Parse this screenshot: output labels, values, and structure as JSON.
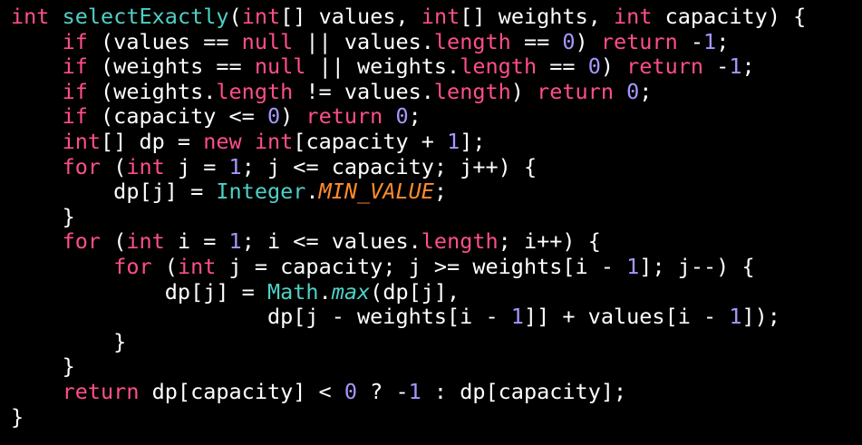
{
  "colors": {
    "background": "#000000",
    "keyword": "#ff4e8c",
    "function_name": "#4fd0c5",
    "number": "#a896ff",
    "plain_text": "#ffffff",
    "constant": "#ff8c2e"
  },
  "code": {
    "lines": [
      [
        {
          "t": "int",
          "c": "kw"
        },
        {
          "t": " ",
          "c": "plain"
        },
        {
          "t": "selectExactly",
          "c": "fn"
        },
        {
          "t": "(",
          "c": "plain"
        },
        {
          "t": "int",
          "c": "kw"
        },
        {
          "t": "[] values, ",
          "c": "plain"
        },
        {
          "t": "int",
          "c": "kw"
        },
        {
          "t": "[] weights, ",
          "c": "plain"
        },
        {
          "t": "int",
          "c": "kw"
        },
        {
          "t": " capacity) {",
          "c": "plain"
        }
      ],
      [
        {
          "t": "    ",
          "c": "plain"
        },
        {
          "t": "if",
          "c": "kw"
        },
        {
          "t": " (values == ",
          "c": "plain"
        },
        {
          "t": "null",
          "c": "kw"
        },
        {
          "t": " || values.",
          "c": "plain"
        },
        {
          "t": "length",
          "c": "kw"
        },
        {
          "t": " == ",
          "c": "plain"
        },
        {
          "t": "0",
          "c": "num"
        },
        {
          "t": ") ",
          "c": "plain"
        },
        {
          "t": "return",
          "c": "kw"
        },
        {
          "t": " -",
          "c": "plain"
        },
        {
          "t": "1",
          "c": "num"
        },
        {
          "t": ";",
          "c": "plain"
        }
      ],
      [
        {
          "t": "    ",
          "c": "plain"
        },
        {
          "t": "if",
          "c": "kw"
        },
        {
          "t": " (weights == ",
          "c": "plain"
        },
        {
          "t": "null",
          "c": "kw"
        },
        {
          "t": " || weights.",
          "c": "plain"
        },
        {
          "t": "length",
          "c": "kw"
        },
        {
          "t": " == ",
          "c": "plain"
        },
        {
          "t": "0",
          "c": "num"
        },
        {
          "t": ") ",
          "c": "plain"
        },
        {
          "t": "return",
          "c": "kw"
        },
        {
          "t": " -",
          "c": "plain"
        },
        {
          "t": "1",
          "c": "num"
        },
        {
          "t": ";",
          "c": "plain"
        }
      ],
      [
        {
          "t": "    ",
          "c": "plain"
        },
        {
          "t": "if",
          "c": "kw"
        },
        {
          "t": " (weights.",
          "c": "plain"
        },
        {
          "t": "length",
          "c": "kw"
        },
        {
          "t": " != values.",
          "c": "plain"
        },
        {
          "t": "length",
          "c": "kw"
        },
        {
          "t": ") ",
          "c": "plain"
        },
        {
          "t": "return",
          "c": "kw"
        },
        {
          "t": " ",
          "c": "plain"
        },
        {
          "t": "0",
          "c": "num"
        },
        {
          "t": ";",
          "c": "plain"
        }
      ],
      [
        {
          "t": "    ",
          "c": "plain"
        },
        {
          "t": "if",
          "c": "kw"
        },
        {
          "t": " (capacity <= ",
          "c": "plain"
        },
        {
          "t": "0",
          "c": "num"
        },
        {
          "t": ") ",
          "c": "plain"
        },
        {
          "t": "return",
          "c": "kw"
        },
        {
          "t": " ",
          "c": "plain"
        },
        {
          "t": "0",
          "c": "num"
        },
        {
          "t": ";",
          "c": "plain"
        }
      ],
      [
        {
          "t": "    ",
          "c": "plain"
        },
        {
          "t": "int",
          "c": "kw"
        },
        {
          "t": "[] dp = ",
          "c": "plain"
        },
        {
          "t": "new",
          "c": "kw"
        },
        {
          "t": " ",
          "c": "plain"
        },
        {
          "t": "int",
          "c": "kw"
        },
        {
          "t": "[capacity + ",
          "c": "plain"
        },
        {
          "t": "1",
          "c": "num"
        },
        {
          "t": "];",
          "c": "plain"
        }
      ],
      [
        {
          "t": "    ",
          "c": "plain"
        },
        {
          "t": "for",
          "c": "kw"
        },
        {
          "t": " (",
          "c": "plain"
        },
        {
          "t": "int",
          "c": "kw"
        },
        {
          "t": " j = ",
          "c": "plain"
        },
        {
          "t": "1",
          "c": "num"
        },
        {
          "t": "; j <= capacity; j++) {",
          "c": "plain"
        }
      ],
      [
        {
          "t": "        dp[j] = ",
          "c": "plain"
        },
        {
          "t": "Integer",
          "c": "fn"
        },
        {
          "t": ".",
          "c": "plain"
        },
        {
          "t": "MIN_VALUE",
          "c": "italic-const"
        },
        {
          "t": ";",
          "c": "plain"
        }
      ],
      [
        {
          "t": "    }",
          "c": "plain"
        }
      ],
      [
        {
          "t": "    ",
          "c": "plain"
        },
        {
          "t": "for",
          "c": "kw"
        },
        {
          "t": " (",
          "c": "plain"
        },
        {
          "t": "int",
          "c": "kw"
        },
        {
          "t": " i = ",
          "c": "plain"
        },
        {
          "t": "1",
          "c": "num"
        },
        {
          "t": "; i <= values.",
          "c": "plain"
        },
        {
          "t": "length",
          "c": "kw"
        },
        {
          "t": "; i++) {",
          "c": "plain"
        }
      ],
      [
        {
          "t": "        ",
          "c": "plain"
        },
        {
          "t": "for",
          "c": "kw"
        },
        {
          "t": " (",
          "c": "plain"
        },
        {
          "t": "int",
          "c": "kw"
        },
        {
          "t": " j = capacity; j >= weights[i - ",
          "c": "plain"
        },
        {
          "t": "1",
          "c": "num"
        },
        {
          "t": "]; j--) {",
          "c": "plain"
        }
      ],
      [
        {
          "t": "            dp[j] = ",
          "c": "plain"
        },
        {
          "t": "Math",
          "c": "fn"
        },
        {
          "t": ".",
          "c": "plain"
        },
        {
          "t": "max",
          "c": "italic-fn"
        },
        {
          "t": "(dp[j],",
          "c": "plain"
        }
      ],
      [
        {
          "t": "                    dp[j - weights[i - ",
          "c": "plain"
        },
        {
          "t": "1",
          "c": "num"
        },
        {
          "t": "]] + values[i - ",
          "c": "plain"
        },
        {
          "t": "1",
          "c": "num"
        },
        {
          "t": "]);",
          "c": "plain"
        }
      ],
      [
        {
          "t": "        }",
          "c": "plain"
        }
      ],
      [
        {
          "t": "    }",
          "c": "plain"
        }
      ],
      [
        {
          "t": "    ",
          "c": "plain"
        },
        {
          "t": "return",
          "c": "kw"
        },
        {
          "t": " dp[capacity] < ",
          "c": "plain"
        },
        {
          "t": "0",
          "c": "num"
        },
        {
          "t": " ? -",
          "c": "plain"
        },
        {
          "t": "1",
          "c": "num"
        },
        {
          "t": " : dp[capacity];",
          "c": "plain"
        }
      ],
      [
        {
          "t": "}",
          "c": "plain"
        }
      ]
    ]
  }
}
